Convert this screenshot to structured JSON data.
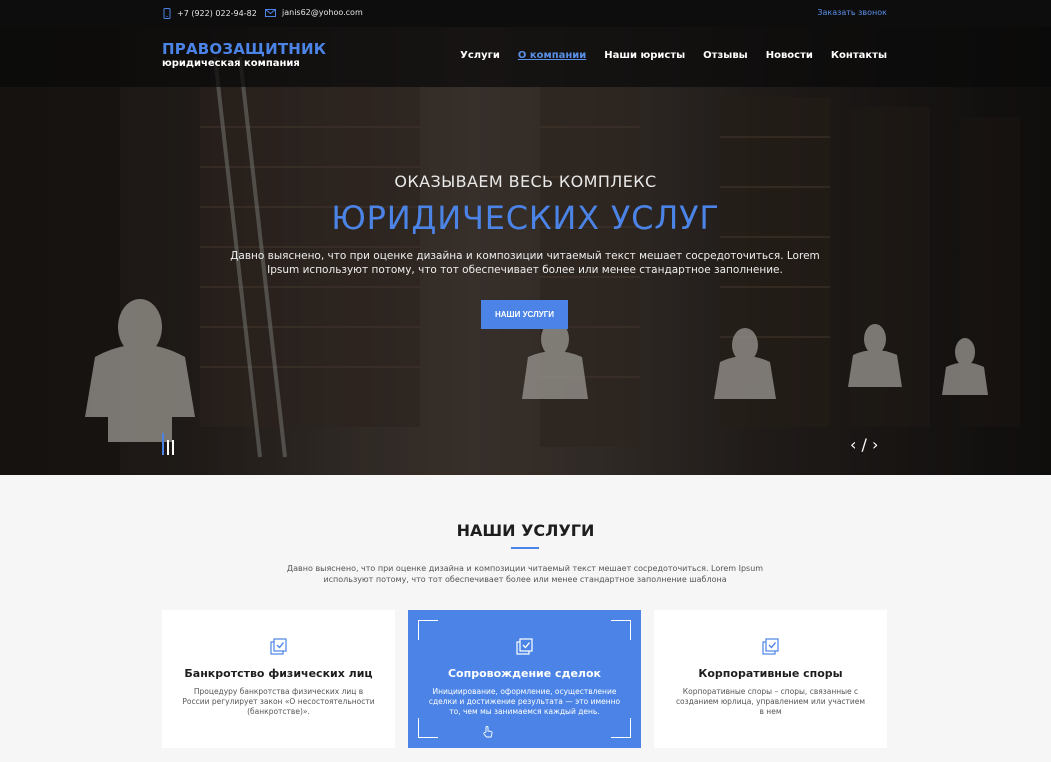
{
  "topbar": {
    "phone": "+7 (922) 022-94-82",
    "email": "janis62@yohoo.com",
    "callback": "Заказать звонок"
  },
  "logo": {
    "title": "ПРАВОЗАЩИТНИК",
    "subtitle": "юридическая компания"
  },
  "nav": {
    "items": [
      {
        "label": "Услуги"
      },
      {
        "label": "О компании"
      },
      {
        "label": "Наши юристы"
      },
      {
        "label": "Отзывы"
      },
      {
        "label": "Новости"
      },
      {
        "label": "Контакты"
      }
    ]
  },
  "hero": {
    "pretitle": "ОКАЗЫВАЕМ ВЕСЬ КОМПЛЕКС",
    "title": "ЮРИДИЧЕСКИХ УСЛУГ",
    "description": "Давно выяснено, что при оценке дизайна и композиции читаемый текст мешает сосредоточиться. Lorem Ipsum используют потому, что тот обеспечивает более или менее стандартное заполнение.",
    "button": "НАШИ УСЛУГИ",
    "arrows": "‹ / ›"
  },
  "services": {
    "title": "НАШИ УСЛУГИ",
    "description": "Давно выяснено, что при оценке дизайна и композиции читаемый текст мешает сосредоточиться. Lorem Ipsum используют потому, что тот обеспечивает более или менее стандартное заполнение шаблона",
    "cards": [
      {
        "title": "Банкротство физических лиц",
        "text": "Процедуру банкротства физических лиц в России регулирует закон «О несостоятельности (банкротстве)»."
      },
      {
        "title": "Сопровождение сделок",
        "text": "Инициирование, оформление, осуществление сделки и достижение результата — это именно то, чем мы занимаемся каждый день."
      },
      {
        "title": "Корпоративные споры",
        "text": "Корпоративные споры – споры, связанные с созданием юрлица, управлением или участием в нем"
      }
    ]
  },
  "colors": {
    "accent": "#4b84e6",
    "topbar": "#0d0d0d",
    "section_bg": "#f6f6f6"
  }
}
